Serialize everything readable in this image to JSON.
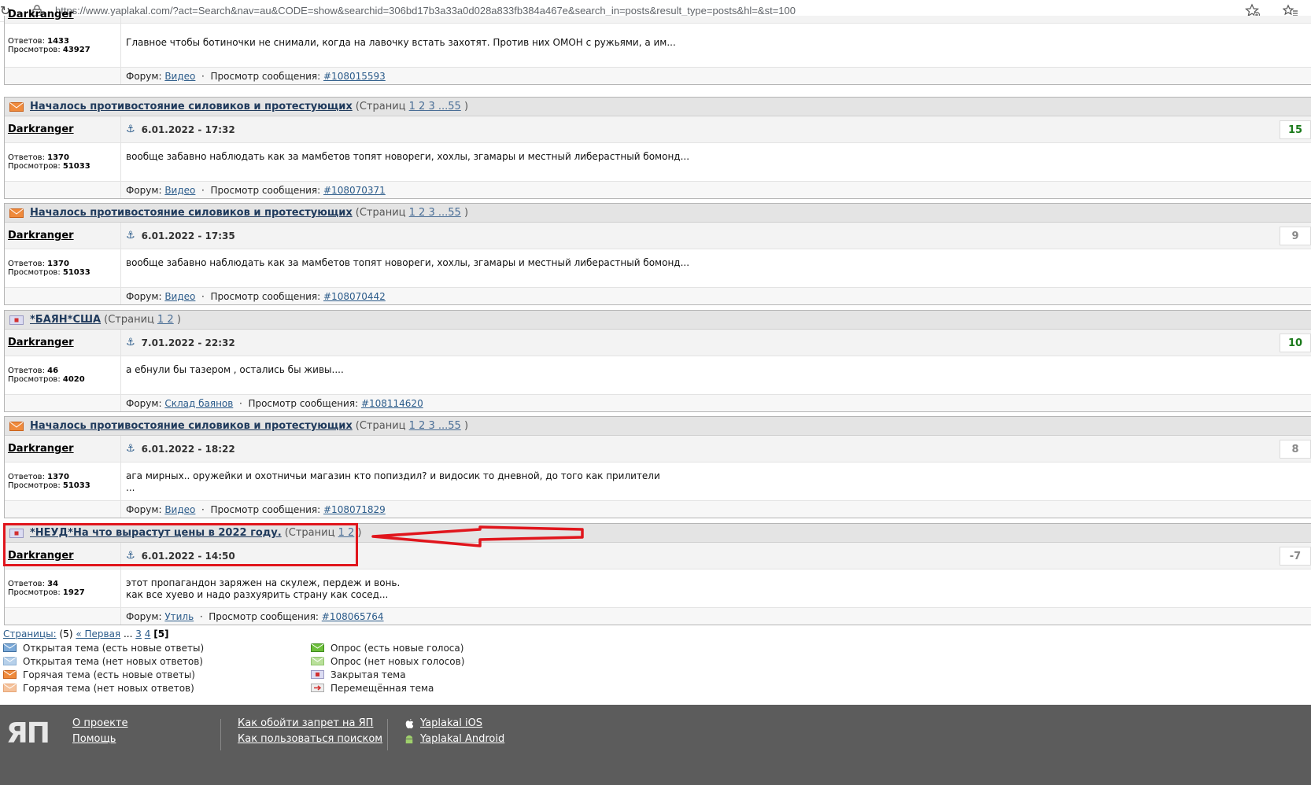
{
  "browser": {
    "url": "https://www.yaplakal.com/?act=Search&nav=au&CODE=show&searchid=306bd17b3a33a0d028a833fb384a467e&search_in=posts&result_type=posts&hl=&st=100"
  },
  "labels": {
    "pages_open": "(Страниц",
    "pages_close": ")",
    "replies": "Ответов:",
    "views": "Просмотров:",
    "forum": "Форум:",
    "view_msg": "Просмотр сообщения:",
    "dot": "·"
  },
  "top_partial": {
    "replies": "1433",
    "views": "43927",
    "text": "Главное чтобы ботиночки не снимали, когда на лавочку встать захотят. Против них ОМОН с ружьями, а им...",
    "forum": "Видео",
    "msg": "#108015593"
  },
  "posts": [
    {
      "title": "Началось противостояние силовиков и протестующих",
      "pages": "1 2 3 ...55",
      "author": "Darkranger",
      "date": "6.01.2022 - 17:32",
      "rating": "15",
      "replies": "1370",
      "views": "51033",
      "text1": "вообще забавно наблюдать как за мамбетов топят новореги, хохлы, згамары и местный либерастный бомонд...",
      "text2": "",
      "forum": "Видео",
      "msg": "#108070371"
    },
    {
      "title": "Началось противостояние силовиков и протестующих",
      "pages": "1 2 3 ...55",
      "author": "Darkranger",
      "date": "6.01.2022 - 17:35",
      "rating": "9",
      "replies": "1370",
      "views": "51033",
      "text1": "вообще забавно наблюдать как за мамбетов топят новореги, хохлы, згамары и местный либерастный бомонд...",
      "text2": "",
      "forum": "Видео",
      "msg": "#108070442"
    },
    {
      "title": "*БАЯН*США",
      "pages": "1 2",
      "author": "Darkranger",
      "date": "7.01.2022 - 22:32",
      "rating": "10",
      "replies": "46",
      "views": "4020",
      "text1": "а ебнули бы тазером , остались бы живы....",
      "text2": "",
      "forum": "Склад баянов",
      "msg": "#108114620"
    },
    {
      "title": "Началось противостояние силовиков и протестующих",
      "pages": "1 2 3 ...55",
      "author": "Darkranger",
      "date": "6.01.2022 - 18:22",
      "rating": "8",
      "replies": "1370",
      "views": "51033",
      "text1": "ага мирных.. оружейки и охотничьи магазин кто попиздил? и видосик то дневной, до того как прилители",
      "text2": "...",
      "forum": "Видео",
      "msg": "#108071829"
    },
    {
      "title": "*НЕУД*На что вырастут цены в 2022 году.",
      "pages": "1 2",
      "author": "Darkranger",
      "date": "6.01.2022 - 14:50",
      "rating": "-7",
      "replies": "34",
      "views": "1927",
      "text1": "этот пропагандон заряжен на скулеж, пердеж и вонь.",
      "text2": "как все хуево и надо разхуярить страну как сосед...",
      "forum": "Утиль",
      "msg": "#108065764"
    }
  ],
  "pager": {
    "label": "Страницы:",
    "count": "(5)",
    "first": "« Первая",
    "dots": "...",
    "p3": "3",
    "p4": "4",
    "current": "[5]"
  },
  "legend": {
    "left": [
      "Открытая тема (есть новые ответы)",
      "Открытая тема (нет новых ответов)",
      "Горячая тема (есть новые ответы)",
      "Горячая тема (нет новых ответов)"
    ],
    "right": [
      "Опрос (есть новые голоса)",
      "Опрос (нет новых голосов)",
      "Закрытая тема",
      "Перемещённая тема"
    ]
  },
  "footer": {
    "logo": "ЯП",
    "about": "О проекте",
    "help": "Помощь",
    "bypass": "Как обойти запрет на ЯП",
    "search": "Как пользоваться поиском",
    "ios": "Yaplakal iOS",
    "android": "Yaplakal Android"
  },
  "colors": {
    "accent_red": "#e0151c",
    "rating_positive": "#1b7a1b",
    "rating_neutral": "#888888"
  }
}
